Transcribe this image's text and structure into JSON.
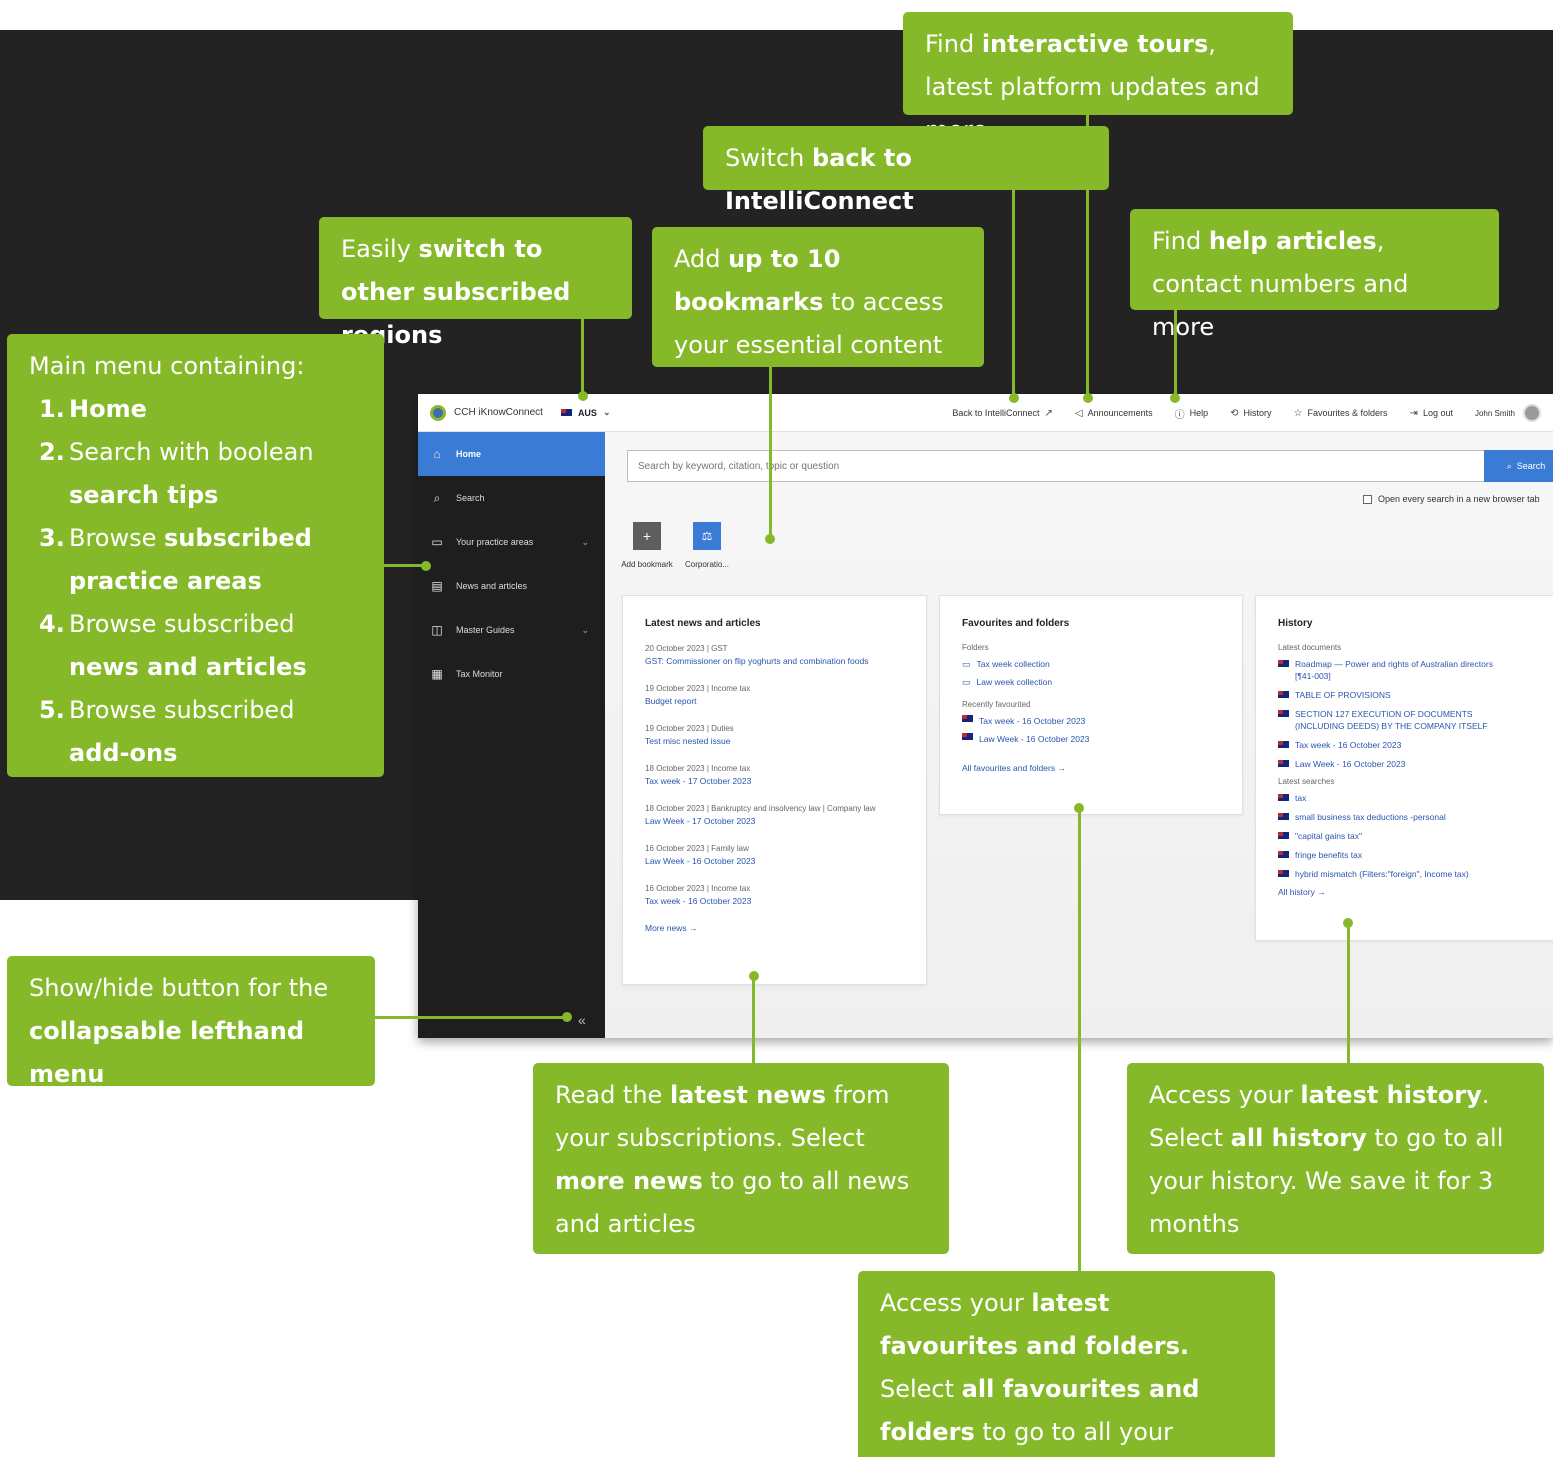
{
  "app": {
    "brand": "CCH iKnowConnect",
    "region": "AUS",
    "top_links": {
      "back": "Back to IntelliConnect",
      "announcements": "Announcements",
      "help": "Help",
      "history": "History",
      "favourites": "Favourites & folders",
      "logout": "Log out",
      "user": "John Smith"
    },
    "sidebar": [
      {
        "label": "Home",
        "icon": "home-icon",
        "active": true
      },
      {
        "label": "Search",
        "icon": "search-icon"
      },
      {
        "label": "Your practice areas",
        "icon": "briefcase-icon",
        "expandable": true
      },
      {
        "label": "News and articles",
        "icon": "newspaper-icon"
      },
      {
        "label": "Master Guides",
        "icon": "book-icon",
        "expandable": true
      },
      {
        "label": "Tax Monitor",
        "icon": "tax-monitor-icon"
      }
    ],
    "search": {
      "placeholder": "Search by keyword, citation, topic or question",
      "button": "Search",
      "new_tab_option": "Open every search in a new browser tab"
    },
    "bookmarks": [
      {
        "label": "Add bookmark",
        "icon": "plus-icon"
      },
      {
        "label": "Corporatio...",
        "icon": "scales-icon"
      }
    ],
    "news": {
      "title": "Latest news and articles",
      "items": [
        {
          "meta": "20 October 2023 | GST",
          "link": "GST: Commissioner on flip yoghurts and combination foods"
        },
        {
          "meta": "19 October 2023 | Income tax",
          "link": "Budget report"
        },
        {
          "meta": "19 October 2023 | Duties",
          "link": "Test misc nested issue"
        },
        {
          "meta": "18 October 2023 | Income tax",
          "link": "Tax week - 17 October 2023"
        },
        {
          "meta": "18 October 2023 | Bankruptcy and insolvency law | Company law",
          "link": "Law Week - 17 October 2023"
        },
        {
          "meta": "16 October 2023 | Family law",
          "link": "Law Week - 16 October 2023"
        },
        {
          "meta": "16 October 2023 | Income tax",
          "link": "Tax week - 16 October 2023"
        }
      ],
      "more": "More news"
    },
    "favourites": {
      "title": "Favourites and folders",
      "folders_label": "Folders",
      "folders": [
        "Tax week collection",
        "Law week collection"
      ],
      "recent_label": "Recently favourited",
      "recent": [
        "Tax week - 16 October 2023",
        "Law Week - 16 October 2023"
      ],
      "all": "All favourites and folders"
    },
    "history": {
      "title": "History",
      "docs_label": "Latest documents",
      "docs": [
        "Roadmap — Power and rights of Australian directors [¶41-003]",
        "TABLE OF PROVISIONS",
        "SECTION 127 EXECUTION OF DOCUMENTS (INCLUDING DEEDS) BY THE COMPANY ITSELF",
        "Tax week - 16 October 2023",
        "Law Week - 16 October 2023"
      ],
      "searches_label": "Latest searches",
      "searches": [
        "tax",
        "small business tax deductions -personal",
        "\"capital gains tax\"",
        "fringe benefits tax",
        "hybrid mismatch (Filters:\"foreign\", Income tax)"
      ],
      "all": "All history"
    }
  },
  "callouts": {
    "tours": {
      "p1": "Find ",
      "b1": "interactive tours",
      "p2": ", latest platform updates and more"
    },
    "switch_back": {
      "p1": "Switch ",
      "b1": "back to IntelliConnect"
    },
    "regions": {
      "p1": "Easily ",
      "b1": "switch to other subscribed regions"
    },
    "bookmarks": {
      "p1": "Add ",
      "b1": "up to 10 bookmarks",
      "p2": " to access your essential content"
    },
    "help": {
      "p1": "Find ",
      "b1": "help articles",
      "p2": ", contact numbers and more"
    },
    "menu": {
      "heading": "Main menu containing:",
      "items": [
        {
          "num": "1.",
          "p1": "",
          "b1": "Home",
          "p2": ""
        },
        {
          "num": "2.",
          "p1": "Search with boolean ",
          "b1": "search tips",
          "p2": ""
        },
        {
          "num": "3.",
          "p1": "Browse ",
          "b1": "subscribed practice areas",
          "p2": ""
        },
        {
          "num": "4.",
          "p1": "Browse subscribed ",
          "b1": "news and articles",
          "p2": ""
        },
        {
          "num": "5.",
          "p1": "Browse subscribed ",
          "b1": "add-ons",
          "p2": ""
        }
      ]
    },
    "collapse": {
      "p1": "Show/hide button for the ",
      "b1": "collapsable lefthand menu"
    },
    "news": {
      "p1": "Read the ",
      "b1": "latest news",
      "p2": " from your subscriptions.  Select ",
      "b2": "more news",
      "p3": " to go to all news and articles"
    },
    "history": {
      "p1": "Access your ",
      "b1": "latest history",
      "p2": ". Select ",
      "b2": "all history",
      "p3": " to go to all your history. We save it for 3 months"
    },
    "favourites": {
      "p1": "Access your ",
      "b1": "latest favourites and folders.",
      "p2": " Select ",
      "b2": "all favourites and folders",
      "p3": " to go to all your favourites and folders"
    }
  },
  "colors": {
    "accent_green": "#85b92a",
    "app_blue": "#3a7bd5",
    "dark_bg": "#232323"
  }
}
